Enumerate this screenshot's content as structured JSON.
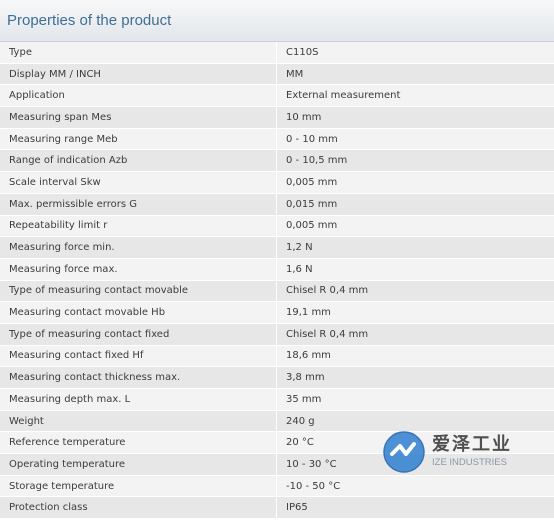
{
  "header": {
    "title": "Properties of the product"
  },
  "rows": [
    {
      "label": "Type",
      "value": "C110S"
    },
    {
      "label": "Display MM / INCH",
      "value": "MM"
    },
    {
      "label": "Application",
      "value": "External measurement"
    },
    {
      "label": "Measuring span Mes",
      "value": "10 mm"
    },
    {
      "label": "Measuring range Meb",
      "value": "0 - 10 mm"
    },
    {
      "label": "Range of indication Azb",
      "value": "0 - 10,5 mm"
    },
    {
      "label": "Scale interval Skw",
      "value": "0,005 mm"
    },
    {
      "label": "Max. permissible errors G",
      "value": "0,015 mm"
    },
    {
      "label": "Repeatability limit r",
      "value": "0,005 mm"
    },
    {
      "label": "Measuring force min.",
      "value": "1,2 N"
    },
    {
      "label": "Measuring force max.",
      "value": "1,6 N"
    },
    {
      "label": "Type of measuring contact movable",
      "value": "Chisel R 0,4 mm"
    },
    {
      "label": "Measuring contact movable Hb",
      "value": "19,1 mm"
    },
    {
      "label": "Type of measuring contact fixed",
      "value": "Chisel R 0,4 mm"
    },
    {
      "label": "Measuring contact fixed Hf",
      "value": "18,6 mm"
    },
    {
      "label": "Measuring contact thickness max.",
      "value": "3,8 mm"
    },
    {
      "label": "Measuring depth max. L",
      "value": "35 mm"
    },
    {
      "label": "Weight",
      "value": "240 g"
    },
    {
      "label": "Reference temperature",
      "value": "20 °C"
    },
    {
      "label": "Operating temperature",
      "value": "10 - 30 °C"
    },
    {
      "label": "Storage temperature",
      "value": "-10 - 50 °C"
    },
    {
      "label": "Protection class",
      "value": "IP65"
    }
  ],
  "watermark": {
    "name_cn": "爱泽工业",
    "name_en": "IZE INDUSTRIES",
    "logo_color": "#2f7fd1"
  }
}
